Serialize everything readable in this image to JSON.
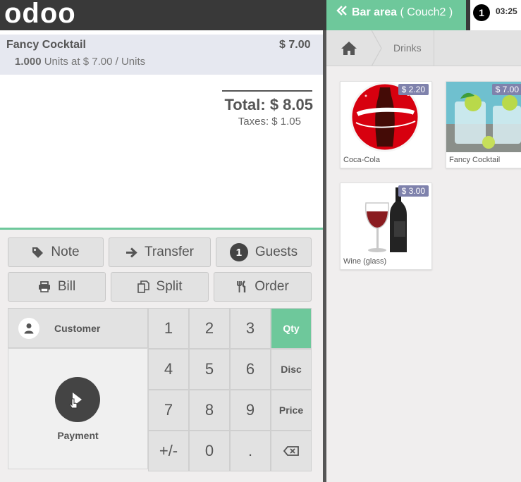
{
  "header": {
    "logo": "odoo",
    "table_button": {
      "label": "Bar area",
      "sublabel": "( Couch2 )"
    },
    "session": {
      "number": "1",
      "time": "03:25"
    }
  },
  "order": {
    "lines": [
      {
        "name": "Fancy Cocktail",
        "price": "$ 7.00",
        "quantity": "1.000",
        "unit_info": "Units at $ 7.00 / Units"
      }
    ],
    "total": "Total: $ 8.05",
    "taxes": "Taxes: $ 1.05"
  },
  "actions": {
    "note": "Note",
    "transfer": "Transfer",
    "guests_count": "1",
    "guests": "Guests",
    "bill": "Bill",
    "split": "Split",
    "order": "Order"
  },
  "numpad": {
    "customer": "Customer",
    "payment": "Payment",
    "keys": [
      "1",
      "2",
      "3",
      "4",
      "5",
      "6",
      "7",
      "8",
      "9",
      "+/-",
      "0",
      "."
    ],
    "modes": {
      "qty": "Qty",
      "disc": "Disc",
      "price": "Price"
    },
    "active_mode": "Qty"
  },
  "products_panel": {
    "breadcrumb": [
      "Drinks"
    ],
    "products": [
      {
        "name": "Coca-Cola",
        "price": "$ 2.20"
      },
      {
        "name": "Fancy Cocktail",
        "price": "$ 7.00"
      },
      {
        "name": "Wine (glass)",
        "price": "$ 3.00"
      }
    ]
  },
  "colors": {
    "accent": "#6ec89b",
    "topbar": "#393939",
    "price_tag": "#7f82ac"
  }
}
